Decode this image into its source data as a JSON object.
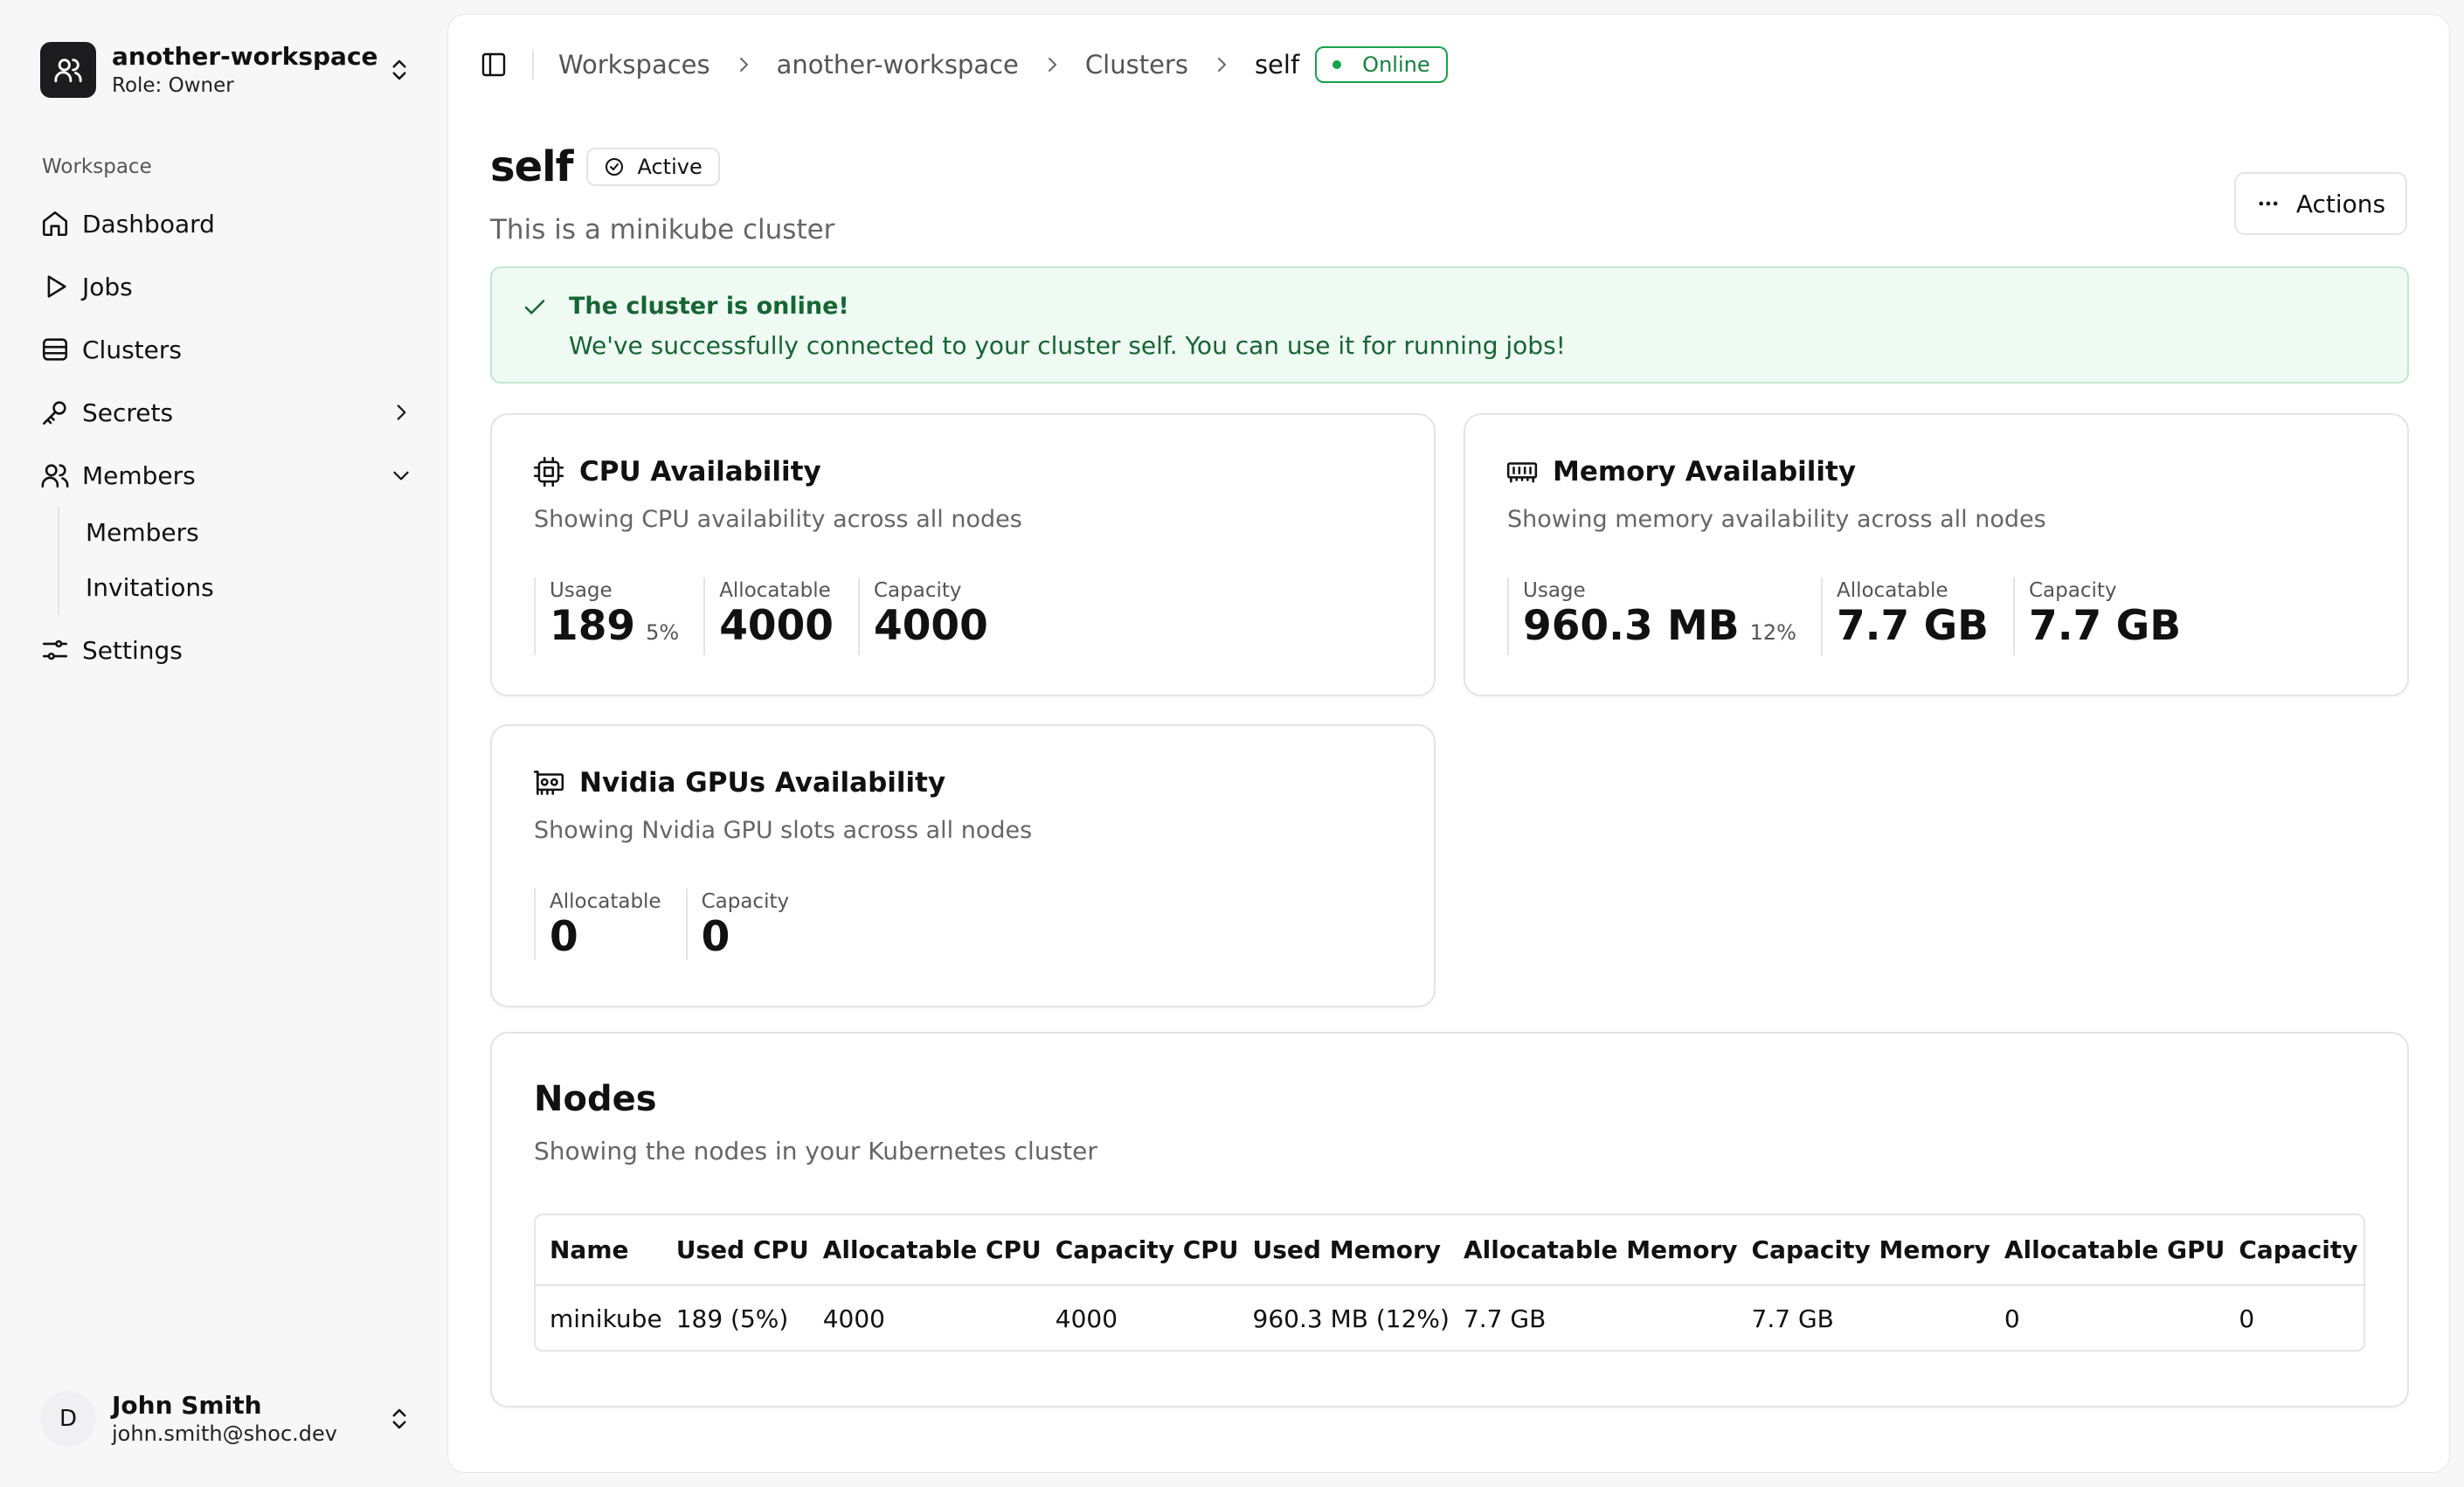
{
  "workspace": {
    "name": "another-workspace",
    "role": "Role: Owner"
  },
  "sidebar": {
    "section_label": "Workspace",
    "items": [
      {
        "label": "Dashboard"
      },
      {
        "label": "Jobs"
      },
      {
        "label": "Clusters"
      },
      {
        "label": "Secrets"
      },
      {
        "label": "Members"
      },
      {
        "label": "Settings"
      }
    ],
    "sub_items": [
      {
        "label": "Members"
      },
      {
        "label": "Invitations"
      }
    ]
  },
  "user": {
    "initial": "D",
    "name": "John Smith",
    "email": "john.smith@shoc.dev"
  },
  "breadcrumb": {
    "items": [
      "Workspaces",
      "another-workspace",
      "Clusters"
    ],
    "current": "self",
    "status": "Online"
  },
  "page": {
    "title": "self",
    "status": "Active",
    "description": "This is a minikube cluster",
    "actions_label": "Actions"
  },
  "alert": {
    "title": "The cluster is online!",
    "body": "We've successfully connected to your cluster self. You can use it for running jobs!"
  },
  "cpu": {
    "title": "CPU Availability",
    "description": "Showing CPU availability across all nodes",
    "usage_label": "Usage",
    "usage": "189",
    "usage_pct": "5%",
    "allocatable_label": "Allocatable",
    "allocatable": "4000",
    "capacity_label": "Capacity",
    "capacity": "4000"
  },
  "memory": {
    "title": "Memory Availability",
    "description": "Showing memory availability across all nodes",
    "usage_label": "Usage",
    "usage": "960.3 MB",
    "usage_pct": "12%",
    "allocatable_label": "Allocatable",
    "allocatable": "7.7 GB",
    "capacity_label": "Capacity",
    "capacity": "7.7 GB"
  },
  "gpu": {
    "title": "Nvidia GPUs Availability",
    "description": "Showing Nvidia GPU slots across all nodes",
    "allocatable_label": "Allocatable",
    "allocatable": "0",
    "capacity_label": "Capacity",
    "capacity": "0"
  },
  "nodes": {
    "title": "Nodes",
    "description": "Showing the nodes in your Kubernetes cluster",
    "columns": [
      "Name",
      "Used CPU",
      "Allocatable CPU",
      "Capacity CPU",
      "Used Memory",
      "Allocatable Memory",
      "Capacity Memory",
      "Allocatable GPU",
      "Capacity GPU"
    ],
    "rows": [
      [
        "minikube",
        "189 (5%)",
        "4000",
        "4000",
        "960.3 MB (12%)",
        "7.7 GB",
        "7.7 GB",
        "0",
        "0"
      ]
    ]
  },
  "colors": {
    "success": "#16a34a",
    "success_bg": "#effaf3",
    "text": "#111111",
    "muted": "#666666"
  }
}
